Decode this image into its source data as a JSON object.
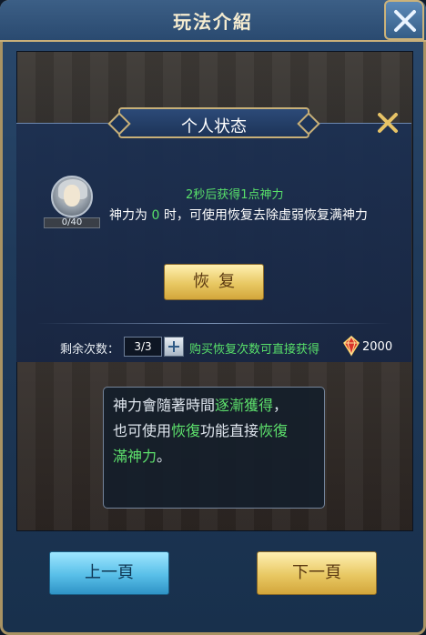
{
  "window": {
    "title": "玩法介紹"
  },
  "dialog": {
    "title": "个人状态",
    "hint": "2秒后获得1点神力",
    "desc_prefix": "神力为 ",
    "desc_zero": "0",
    "desc_suffix": " 时，可使用恢复去除虚弱恢复满神力",
    "progress_text": "0/40",
    "progress_fraction": 0,
    "restore_label": "恢复",
    "remaining_label": "剩余次数：",
    "remaining_value": "3/3",
    "buy_text": "购买恢复次数可直接获得",
    "gem_amount": "2000"
  },
  "info": {
    "line1_a": "神力會隨著時間",
    "line1_b": "逐漸獲得",
    "line1_c": "，",
    "line2_a": "也可使用",
    "line2_b": "恢復",
    "line2_c": "功能直接",
    "line2_d": "恢復",
    "line3_a": "滿神力",
    "line3_b": "。"
  },
  "nav": {
    "prev_label": "上一頁",
    "next_label": "下一頁"
  },
  "icons": {
    "close": "close-icon",
    "dialog_close": "x-icon",
    "plus": "plus-icon",
    "gem": "gem-icon",
    "avatar": "character-portrait"
  },
  "colors": {
    "accent_green": "#58e06a",
    "gold_border": "#c8b078"
  }
}
